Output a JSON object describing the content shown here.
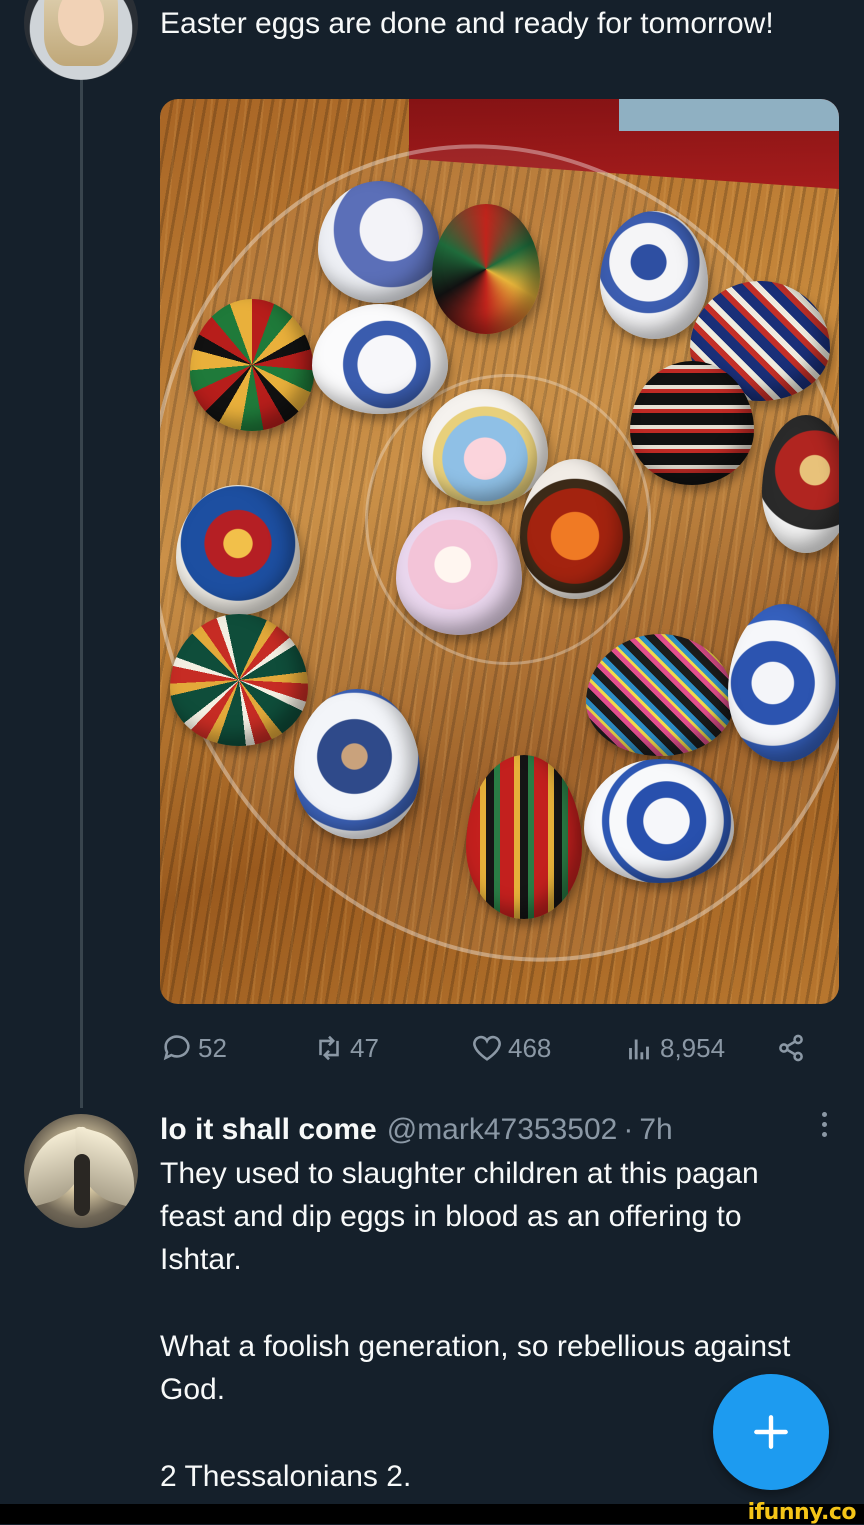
{
  "original_tweet": {
    "text": "Easter eggs are done and ready for tomorrow!",
    "media_alt": "Tray of decorated Easter eggs on a wooden table",
    "actions": {
      "replies": "52",
      "retweets": "47",
      "likes": "468",
      "views": "8,954"
    }
  },
  "reply": {
    "display_name": "lo it shall come",
    "handle": "@mark47353502",
    "separator": "·",
    "time": "7h",
    "paragraphs": [
      "They used to slaughter children at this pagan feast and dip eggs in blood as an offering to Ishtar.",
      "What a foolish generation, so rebellious against God.",
      "2 Thessalonians 2."
    ]
  },
  "watermark": "ifunny.co",
  "colors": {
    "background": "#15202b",
    "text": "#f7f9f9",
    "muted": "#8b98a5",
    "accent": "#1d9bf0"
  },
  "icons": [
    "reply-icon",
    "retweet-icon",
    "like-icon",
    "views-icon",
    "share-icon",
    "more-icon",
    "plus-icon"
  ]
}
